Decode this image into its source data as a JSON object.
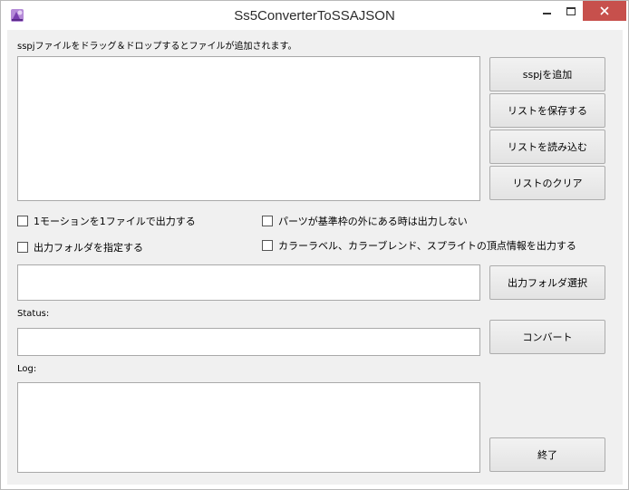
{
  "window": {
    "title": "Ss5ConverterToSSAJSON",
    "controls": {
      "close_glyph": "✕"
    }
  },
  "form": {
    "drop_hint": "sspjファイルをドラッグ＆ドロップするとファイルが追加されます。",
    "buttons": {
      "add_sspj": "sspjを追加",
      "save_list": "リストを保存する",
      "load_list": "リストを読み込む",
      "clear_list": "リストのクリア",
      "select_output_folder": "出力フォルダ選択",
      "convert": "コンバート",
      "exit": "終了"
    },
    "checkboxes": {
      "one_motion_one_file": {
        "label": "1モーションを1ファイルで出力する",
        "checked": false
      },
      "specify_output_folder": {
        "label": "出力フォルダを指定する",
        "checked": false
      },
      "no_output_outside_frame": {
        "label": "パーツが基準枠の外にある時は出力しない",
        "checked": false
      },
      "output_color_label": {
        "label": "カラーラベル、カラーブレンド、スプライトの頂点情報を出力する",
        "checked": false
      }
    },
    "output_folder_value": "",
    "status_label": "Status:",
    "status_value": "",
    "log_label": "Log:",
    "log_value": ""
  }
}
